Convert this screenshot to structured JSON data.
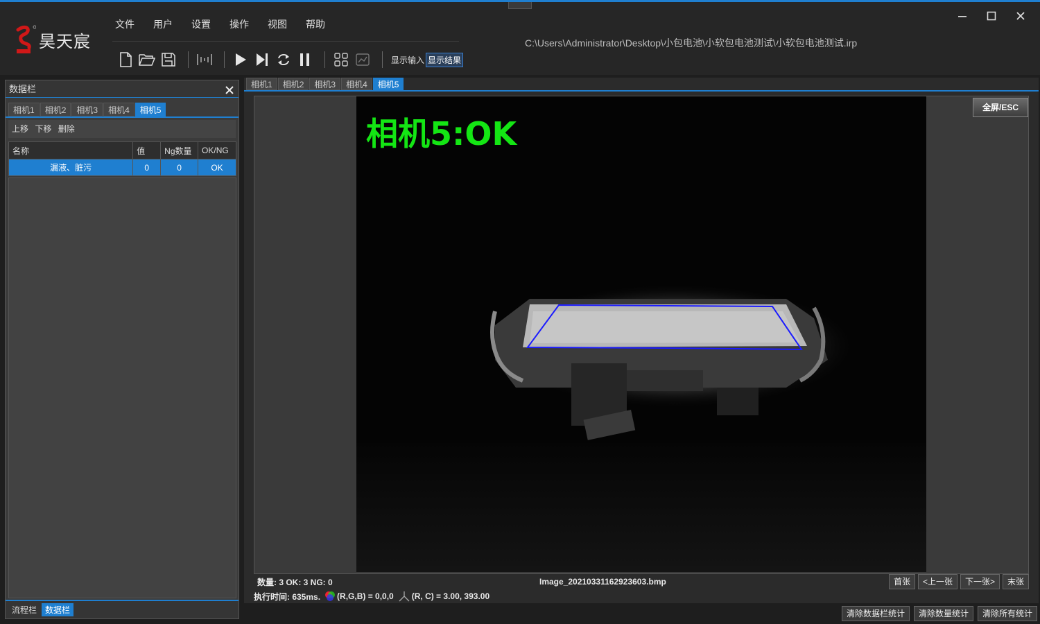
{
  "app": {
    "brand": "昊天宸",
    "path": "C:\\Users\\Administrator\\Desktop\\小包电池\\小软包电池测试\\小软包电池测试.irp"
  },
  "menu": [
    "文件",
    "用户",
    "设置",
    "操作",
    "视图",
    "帮助"
  ],
  "toolbar": {
    "show_input": "显示输入",
    "show_result": "显示结果"
  },
  "left_panel": {
    "title": "数据栏",
    "tabs": [
      "相机1",
      "相机2",
      "相机3",
      "相机4",
      "相机5"
    ],
    "actions": [
      "上移",
      "下移",
      "删除"
    ],
    "columns": [
      "名称",
      "值",
      "Ng数量",
      "OK/NG"
    ],
    "rows": [
      {
        "name": "漏液、脏污",
        "value": "0",
        "ng": "0",
        "result": "OK"
      }
    ],
    "bottom_tabs": [
      "流程栏",
      "数据栏"
    ]
  },
  "right": {
    "tabs": [
      "相机1",
      "相机2",
      "相机3",
      "相机4",
      "相机5"
    ],
    "overlay_text": "相机5:OK",
    "fullscreen_label": "全屏/ESC",
    "counts": "数量: 3 OK: 3 NG: 0",
    "filename": "Image_20210331162923603.bmp",
    "nav": [
      "首张",
      "<上一张",
      "下一张>",
      "末张"
    ],
    "exec_time": "执行时间: 635ms.",
    "rgb": "(R,G,B) = 0,0,0",
    "rc": "(R, C) = 3.00, 393.00"
  },
  "bottom_buttons": [
    "清除数据栏统计",
    "清除数量统计",
    "清除所有统计"
  ],
  "colors": {
    "accent": "#1f7fd0",
    "ok_green": "#14e614",
    "roi_blue": "#1b1bff"
  }
}
